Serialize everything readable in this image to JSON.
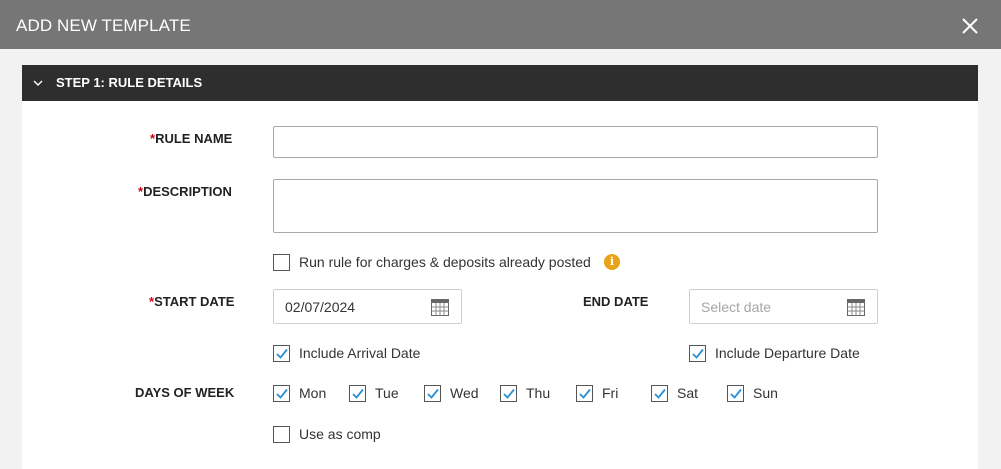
{
  "modal": {
    "title": "ADD NEW TEMPLATE",
    "close_icon": "close-icon"
  },
  "step": {
    "title": "STEP 1: RULE DETAILS",
    "chevron_icon": "chevron-down-icon"
  },
  "form": {
    "required_marker": "*",
    "rule_name": {
      "label": "RULE NAME",
      "value": "",
      "placeholder": ""
    },
    "description": {
      "label": "DESCRIPTION",
      "value": "",
      "placeholder": ""
    },
    "run_rule": {
      "label": "Run rule for charges & deposits already posted",
      "checked": false,
      "info_icon": "info-icon"
    },
    "start_date": {
      "label": "START DATE",
      "value": "02/07/2024"
    },
    "end_date": {
      "label": "END DATE",
      "value": "",
      "placeholder": "Select date"
    },
    "include_arrival": {
      "label": "Include Arrival Date",
      "checked": true
    },
    "include_departure": {
      "label": "Include Departure Date",
      "checked": true
    },
    "days_of_week": {
      "label": "DAYS OF WEEK",
      "days": [
        {
          "label": "Mon",
          "checked": true
        },
        {
          "label": "Tue",
          "checked": true
        },
        {
          "label": "Wed",
          "checked": true
        },
        {
          "label": "Thu",
          "checked": true
        },
        {
          "label": "Fri",
          "checked": true
        },
        {
          "label": "Sat",
          "checked": true
        },
        {
          "label": "Sun",
          "checked": true
        }
      ]
    },
    "use_as_comp": {
      "label": "Use as comp",
      "checked": false
    }
  },
  "colors": {
    "header_bg": "#767676",
    "step_header_bg": "#2e2e2e",
    "required": "#d0021b",
    "checkmark": "#2a8fd6",
    "info": "#e8a317"
  }
}
